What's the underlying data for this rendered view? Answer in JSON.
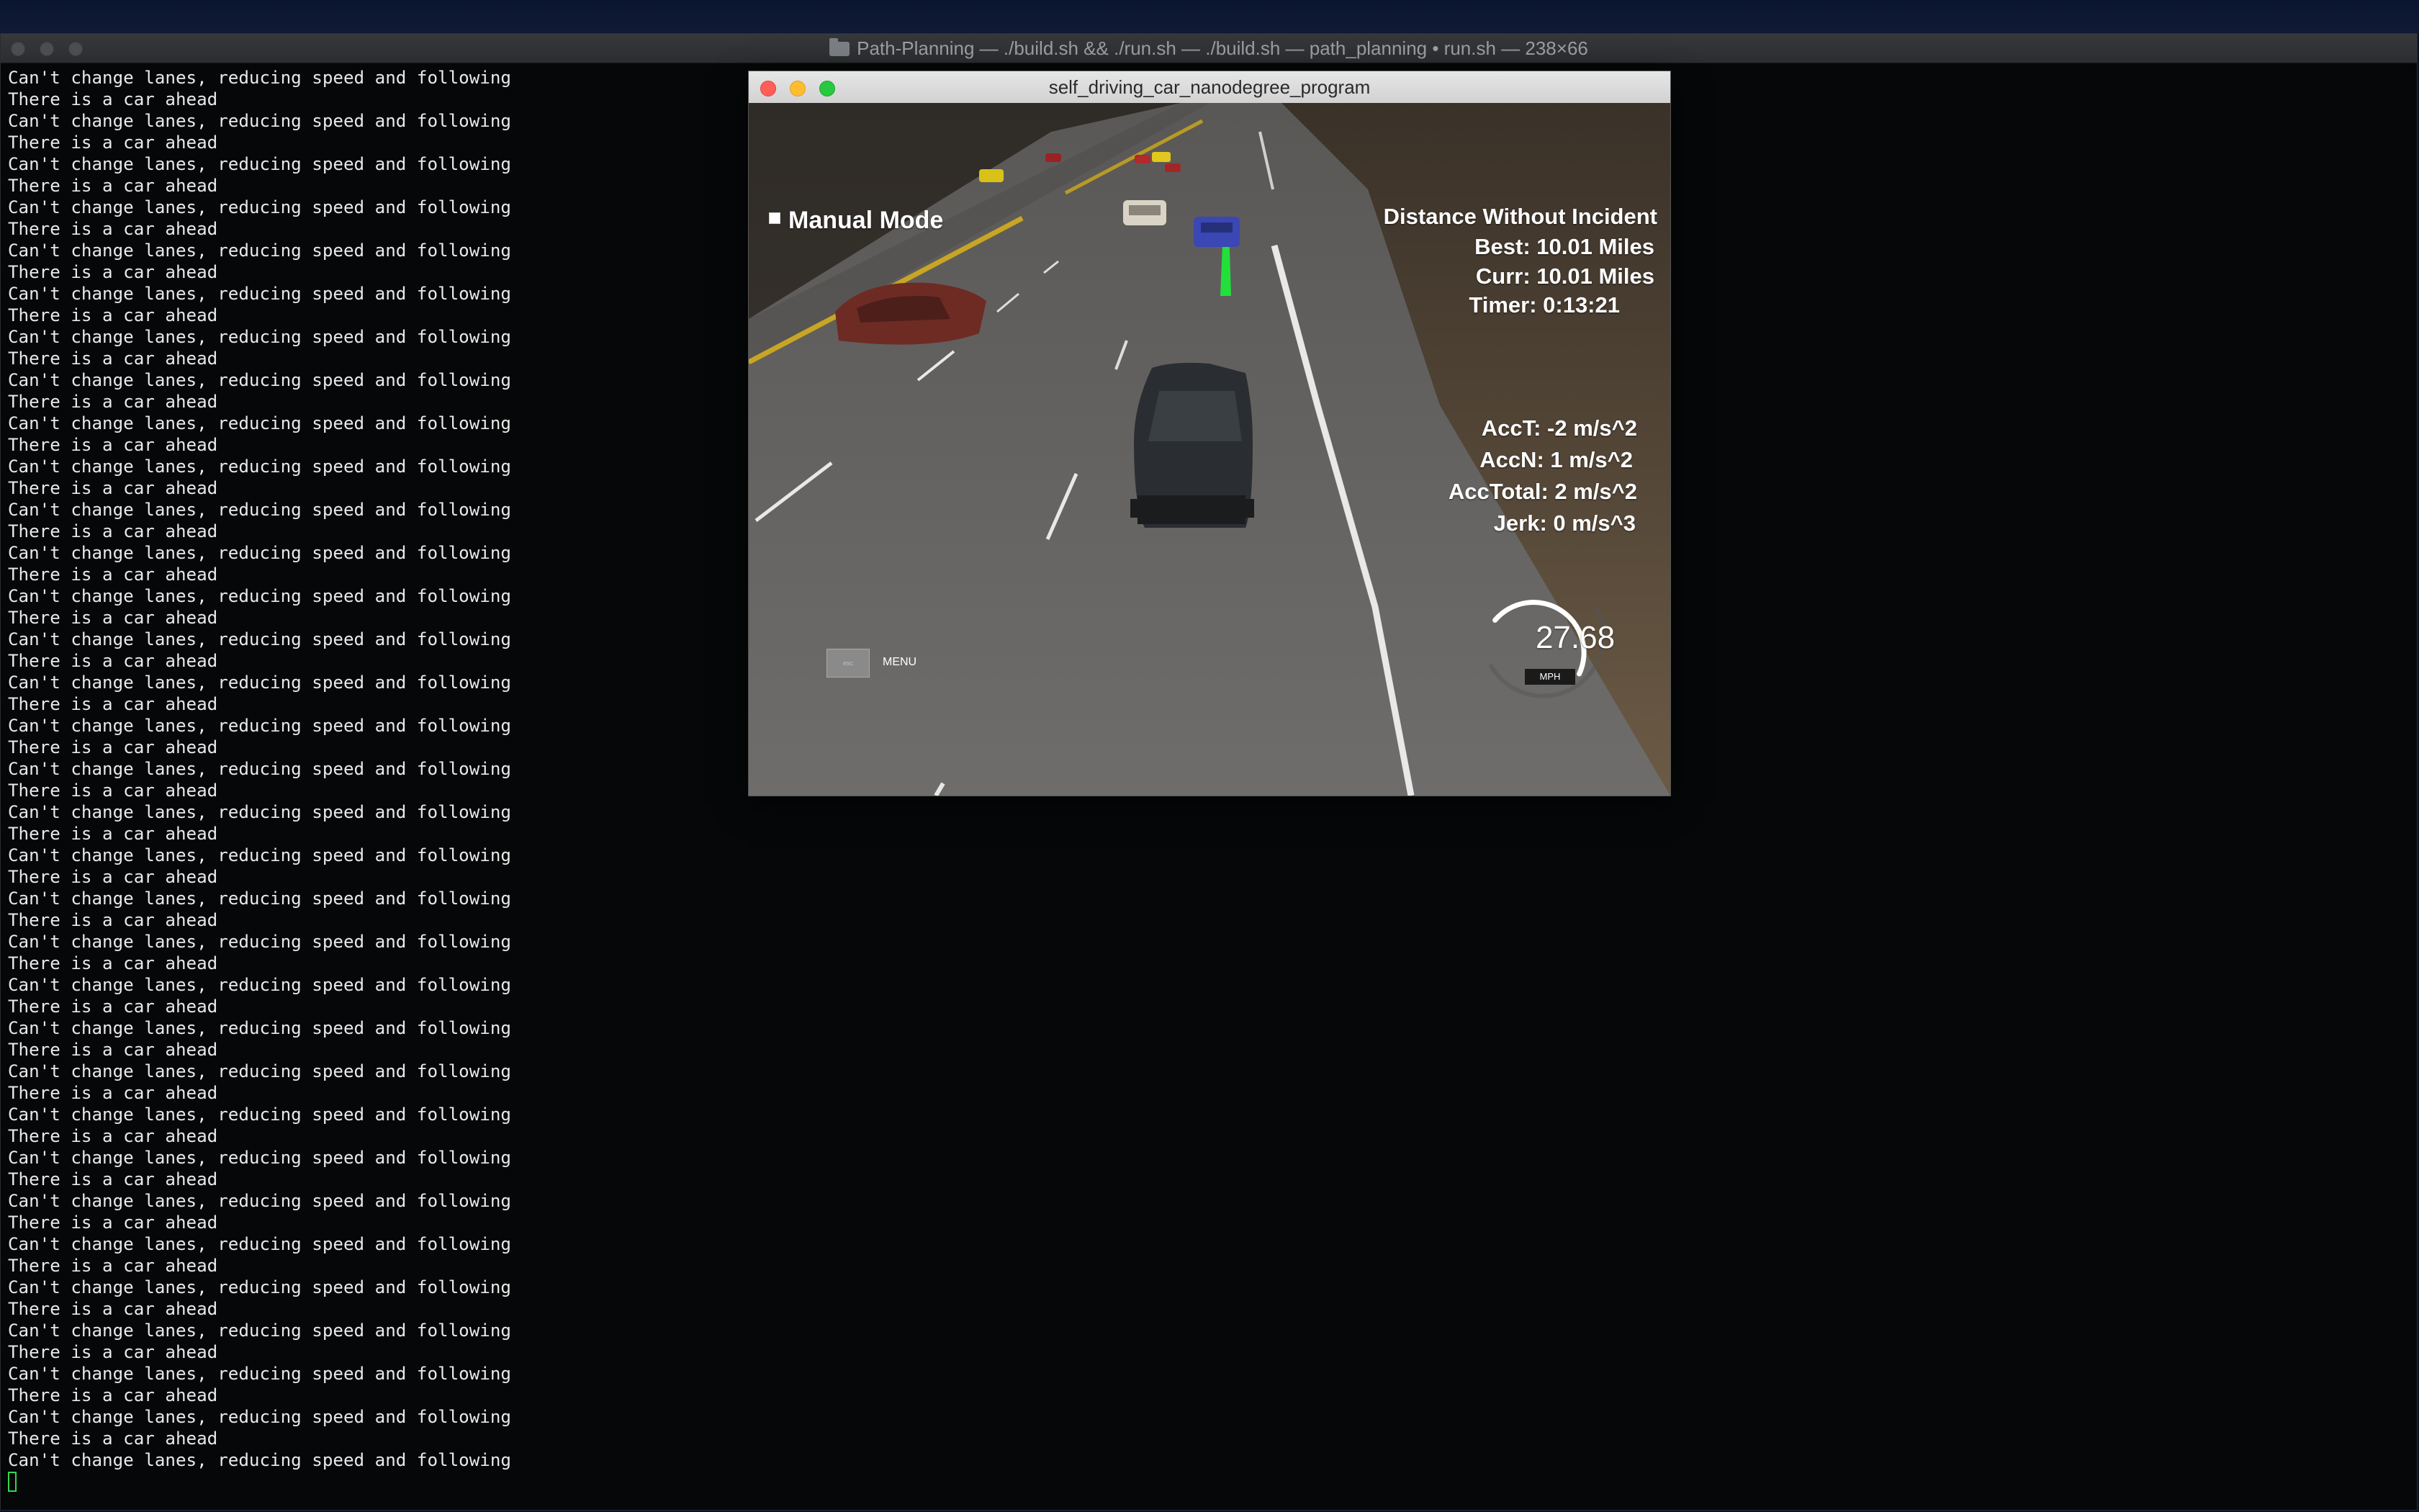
{
  "terminal": {
    "title": "Path-Planning — ./build.sh && ./run.sh — ./build.sh — path_planning • run.sh — 238×66",
    "line_a": "Can't change lanes, reducing speed and following",
    "line_b": "There is a car ahead",
    "line_count": 65
  },
  "simulator": {
    "title": "self_driving_car_nanodegree_program",
    "manual_mode_label": "Manual Mode",
    "stats": {
      "heading": "Distance Without Incident",
      "best": "Best: 10.01 Miles",
      "curr": "Curr: 10.01 Miles",
      "timer": "Timer: 0:13:21"
    },
    "accel": {
      "acc_t": "AccT: -2 m/s^2",
      "acc_n": "AccN: 1 m/s^2",
      "acc_total": "AccTotal: 2 m/s^2",
      "jerk": "Jerk: 0 m/s^3"
    },
    "speedometer": {
      "value": "27.68",
      "unit": "MPH",
      "gauge_fraction": 0.55
    },
    "esc_label": "esc",
    "menu_label": "MENU"
  },
  "colors": {
    "path_line": "#22e03a",
    "terminal_cursor": "#32d74b",
    "close": "#ff5f57",
    "minimize": "#febc2e",
    "maximize": "#28c840"
  }
}
